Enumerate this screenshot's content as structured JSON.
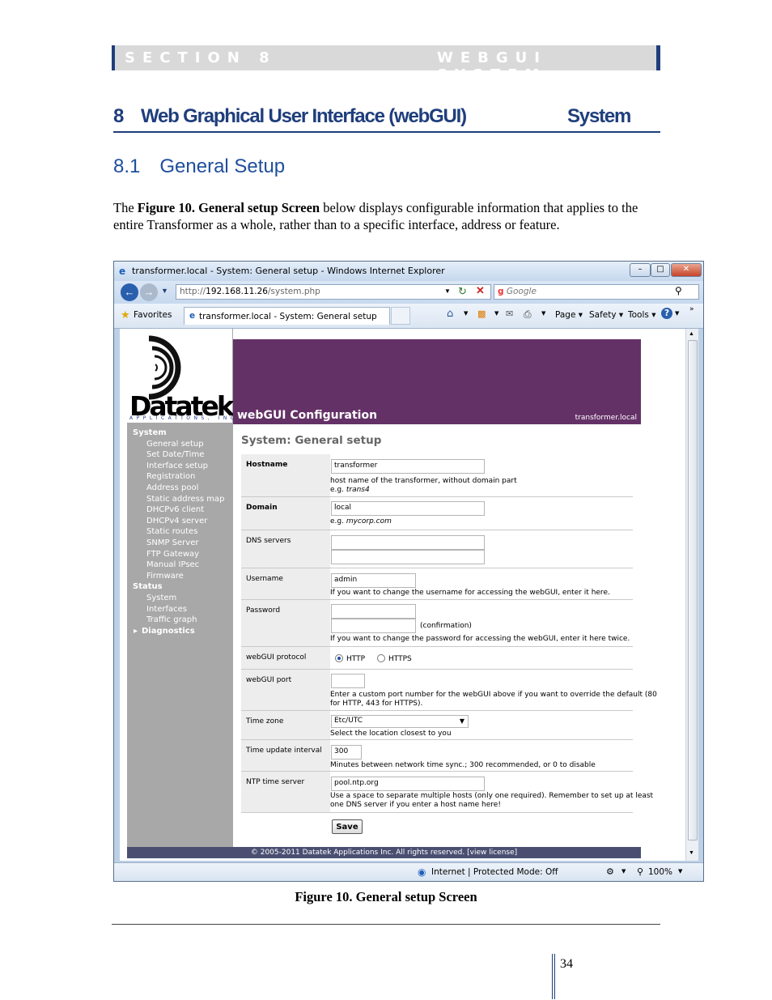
{
  "header": {
    "section": "SECTION 8",
    "title": "WEBGUI SYSTEM"
  },
  "heading": {
    "number": "8",
    "title": "Web Graphical User Interface (webGUI)",
    "subtitle": "System"
  },
  "subheading": {
    "number": "8.1",
    "title": "General Setup"
  },
  "intro": {
    "lead": "The ",
    "figure_ref": "Figure 10. General setup Screen",
    "text": "  below displays configurable information that applies to the entire Transformer as a whole, rather than to a specific interface, address or feature."
  },
  "browser": {
    "window_title": "transformer.local - System: General setup - Windows Internet Explorer",
    "url_prefix": "http://",
    "url_host": "192.168.11.26",
    "url_path": "/system.php",
    "search_placeholder": "Google",
    "favorites_label": "Favorites",
    "tab_title": "transformer.local - System: General setup",
    "menu": [
      "Page",
      "Safety",
      "Tools"
    ],
    "status_zone": "Internet | Protected Mode: Off",
    "zoom": "100%"
  },
  "app": {
    "logo_text": "Datatek",
    "logo_sub": "APPLICATIONS, INC",
    "banner_title": "webGUI Configuration",
    "hostname_badge": "transformer.local",
    "page_title": "System: General setup",
    "footer": "© 2005-2011 Datatek Applications Inc. All rights reserved.  [view license]",
    "nav": [
      {
        "label": "System",
        "header": true
      },
      {
        "label": "General setup"
      },
      {
        "label": "Set Date/Time"
      },
      {
        "label": "Interface setup"
      },
      {
        "label": "Registration"
      },
      {
        "label": "Address pool"
      },
      {
        "label": "Static address map"
      },
      {
        "label": "DHCPv6 client"
      },
      {
        "label": "DHCPv4 server"
      },
      {
        "label": "Static routes"
      },
      {
        "label": "SNMP Server"
      },
      {
        "label": "FTP Gateway"
      },
      {
        "label": "Manual IPsec"
      },
      {
        "label": "Firmware"
      },
      {
        "label": "Status",
        "header": true
      },
      {
        "label": "System"
      },
      {
        "label": "Interfaces"
      },
      {
        "label": "Traffic graph"
      },
      {
        "label": "Diagnostics",
        "header": true
      }
    ],
    "form": {
      "hostname": {
        "label": "Hostname",
        "value": "transformer",
        "hint": "host name of the transformer, without domain part",
        "example_prefix": "e.g. ",
        "example": "trans4"
      },
      "domain": {
        "label": "Domain",
        "value": "local",
        "example_prefix": "e.g. ",
        "example": "mycorp.com"
      },
      "dns": {
        "label": "DNS servers",
        "value1": "",
        "value2": ""
      },
      "username": {
        "label": "Username",
        "value": "admin",
        "hint": "If you want to change the username for accessing the webGUI, enter it here."
      },
      "password": {
        "label": "Password",
        "confirm": "(confirmation)",
        "hint": "If you want to change the password for accessing the webGUI, enter it here twice."
      },
      "protocol": {
        "label": "webGUI protocol",
        "opt1": "HTTP",
        "opt2": "HTTPS",
        "selected": "HTTP"
      },
      "port": {
        "label": "webGUI port",
        "value": "",
        "hint1": "Enter a custom port number for the webGUI above if you want to override the default (80",
        "hint2": "for HTTP, 443 for HTTPS)."
      },
      "timezone": {
        "label": "Time zone",
        "value": "Etc/UTC",
        "hint": "Select the location closest to you"
      },
      "interval": {
        "label": "Time update interval",
        "value": "300",
        "hint": "Minutes between network time sync.; 300 recommended, or 0 to disable"
      },
      "ntp": {
        "label": "NTP time server",
        "value": "pool.ntp.org",
        "hint1": "Use a space to separate multiple hosts (only one required). Remember to set up at least",
        "hint2": "one DNS server if you enter a host name here!"
      },
      "save": "Save"
    }
  },
  "caption": "Figure 10. General setup Screen",
  "page_number": "34"
}
